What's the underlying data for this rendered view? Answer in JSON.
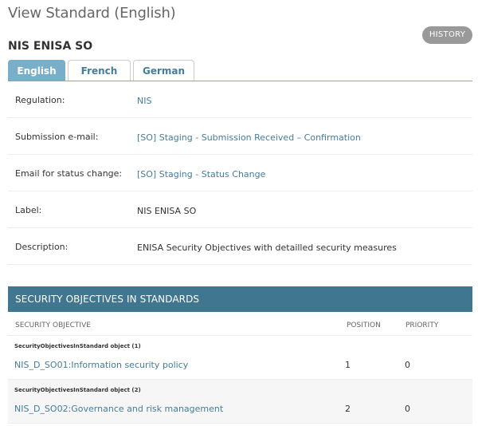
{
  "page": {
    "title": "View Standard (English)",
    "object_title": "NIS ENISA SO",
    "history_label": "HISTORY"
  },
  "tabs": [
    {
      "label": "English",
      "active": true
    },
    {
      "label": "French",
      "active": false
    },
    {
      "label": "German",
      "active": false
    }
  ],
  "fields": [
    {
      "label": "Regulation:",
      "value": "NIS",
      "is_link": true
    },
    {
      "label": "Submission e-mail:",
      "value": "[SO] Staging - Submission Received – Confirmation",
      "is_link": true
    },
    {
      "label": "Email for status change:",
      "value": "[SO] Staging - Status Change",
      "is_link": true
    },
    {
      "label": "Label:",
      "value": "NIS ENISA SO",
      "is_link": false
    },
    {
      "label": "Description:",
      "value": "ENISA Security Objectives with detailled security measures",
      "is_link": false
    }
  ],
  "inline": {
    "title": "SECURITY OBJECTIVES IN STANDARDS",
    "columns": {
      "objective": "SECURITY OBJECTIVE",
      "position": "POSITION",
      "priority": "PRIORITY"
    },
    "rows": [
      {
        "caption": "SecurityObjectivesInStandard object (1)",
        "objective": "NIS_D_SO01:Information security policy",
        "position": "1",
        "priority": "0"
      },
      {
        "caption": "SecurityObjectivesInStandard object (2)",
        "objective": "NIS_D_SO02:Governance and risk management",
        "position": "2",
        "priority": "0"
      }
    ]
  },
  "colors": {
    "header_bg": "#417690",
    "active_tab_bg": "#79aec8",
    "link": "#447e9b",
    "history_bg": "#999999"
  }
}
